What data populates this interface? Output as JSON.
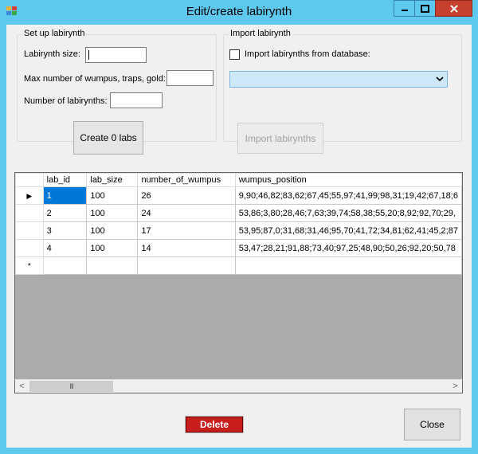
{
  "window": {
    "title": "Edit/create labirynth"
  },
  "setup": {
    "group_title": "Set up labirynth",
    "size_label": "Labirynth size:",
    "size_value": "",
    "max_label": "Max number of wumpus, traps, gold:",
    "max_value": "",
    "count_label": "Number of labirynths:",
    "count_value": "",
    "create_button": "Create 0 labs"
  },
  "import": {
    "group_title": "Import labirynth",
    "checkbox_label": "Import labirynths from database:",
    "checked": false,
    "combo_value": "",
    "import_button": "Import labirynths"
  },
  "grid": {
    "columns": [
      "lab_id",
      "lab_size",
      "number_of_wumpus",
      "wumpus_position"
    ],
    "rows": [
      [
        "1",
        "100",
        "26",
        "9,90;46,82;83,62;67,45;55,97;41,99;98,31;19,42;67,18;6"
      ],
      [
        "2",
        "100",
        "24",
        "53,86;3,80;28,46;7,63;39,74;58,38;55,20;8,92;92,70;29,"
      ],
      [
        "3",
        "100",
        "17",
        "53,95;87,0;31,68;31,46;95,70;41,72;34,81;62,41;45,2;87"
      ],
      [
        "4",
        "100",
        "14",
        "53,47;28,21;91,88;73,40;97,25;48,90;50,26;92,20;50,78"
      ]
    ],
    "new_row_marker": "*",
    "current_row_marker": "▶",
    "scroll_thumb_grip": "III"
  },
  "footer": {
    "delete_button": "Delete",
    "close_button": "Close"
  },
  "colors": {
    "titlebar": "#5ec9ee",
    "close_caption": "#c7402d",
    "selection": "#0078d7",
    "delete": "#c81e1e"
  }
}
